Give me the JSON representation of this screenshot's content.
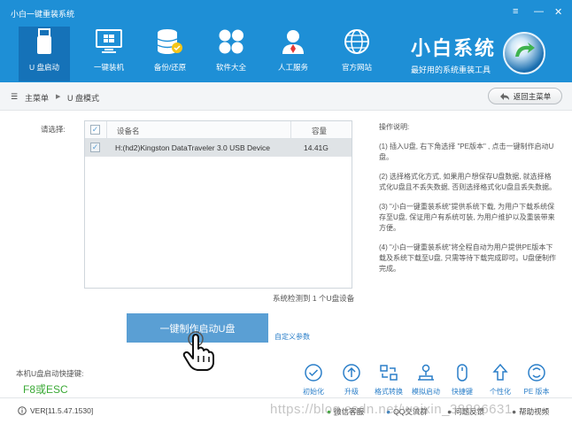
{
  "app": {
    "title": "小白一键重装系统",
    "window_controls": {
      "menu": "≡",
      "minimize": "—",
      "close": "✕"
    }
  },
  "nav": {
    "items": [
      {
        "label": "U 盘启动",
        "icon": "usb-drive-icon",
        "active": true
      },
      {
        "label": "一键装机",
        "icon": "monitor-windows-icon"
      },
      {
        "label": "备份/还原",
        "icon": "database-backup-icon"
      },
      {
        "label": "软件大全",
        "icon": "apps-grid-icon"
      },
      {
        "label": "人工服务",
        "icon": "support-person-icon"
      },
      {
        "label": "官方网站",
        "icon": "globe-icon"
      }
    ]
  },
  "brand": {
    "name": "小白系统",
    "tagline": "最好用的系统重装工具"
  },
  "breadcrumb": {
    "home": "主菜单",
    "separator": "▶",
    "current": "U 盘模式"
  },
  "back_button": {
    "label": "返回主菜单"
  },
  "device_selector": {
    "label": "请选择:",
    "columns": {
      "name": "设备名",
      "capacity": "容量"
    },
    "rows": [
      {
        "name": "H:(hd2)Kingston DataTraveler 3.0 USB Device",
        "capacity": "14.41G",
        "checked": true
      }
    ],
    "detected": "系统检测到 1 个U盘设备"
  },
  "instructions": {
    "title": "操作说明:",
    "steps": [
      "(1) 插入U盘, 右下角选择 \"PE版本\" , 点击一键制作启动U盘。",
      "(2) 选择格式化方式, 如果用户想保存U盘数据, 就选择格式化U盘且不丢失数据, 否则选择格式化U盘且丢失数据。",
      "(3) \"小白一键重装系统\"提供系统下载, 为用户下载系统保存至U盘, 保证用户有系统可装, 为用户维护以及重装带来方便。",
      "(4) \"小白一键重装系统\"将全程自动为用户提供PE版本下载及系统下载至U盘, 只需等待下载完成即可。U盘便制作完成。"
    ]
  },
  "make_button": {
    "label": "一键制作启动U盘"
  },
  "custom_params": {
    "label": "自定义参数"
  },
  "hotkey": {
    "label": "本机U盘启动快捷键:",
    "value": "F8或ESC"
  },
  "tools": [
    {
      "label": "初始化",
      "icon": "init-check-icon"
    },
    {
      "label": "升级",
      "icon": "upgrade-arrow-icon"
    },
    {
      "label": "格式转换",
      "icon": "format-convert-icon"
    },
    {
      "label": "模拟启动",
      "icon": "simulate-boot-icon"
    },
    {
      "label": "快捷键",
      "icon": "mouse-icon"
    },
    {
      "label": "个性化",
      "icon": "personalize-icon"
    },
    {
      "label": "PE 版本",
      "icon": "pe-version-icon"
    }
  ],
  "status": {
    "version": "VER[11.5.47.1530]",
    "links": [
      "微信客服",
      "QQ交流群",
      "问题反馈",
      "帮助视频"
    ]
  },
  "watermark": "https://blog.csdn.net/weixin_38896631",
  "colors": {
    "header": "#1e8fd6",
    "accent": "#5a9fd4",
    "hotkey": "#3aa935",
    "link": "#2b7fc9"
  }
}
